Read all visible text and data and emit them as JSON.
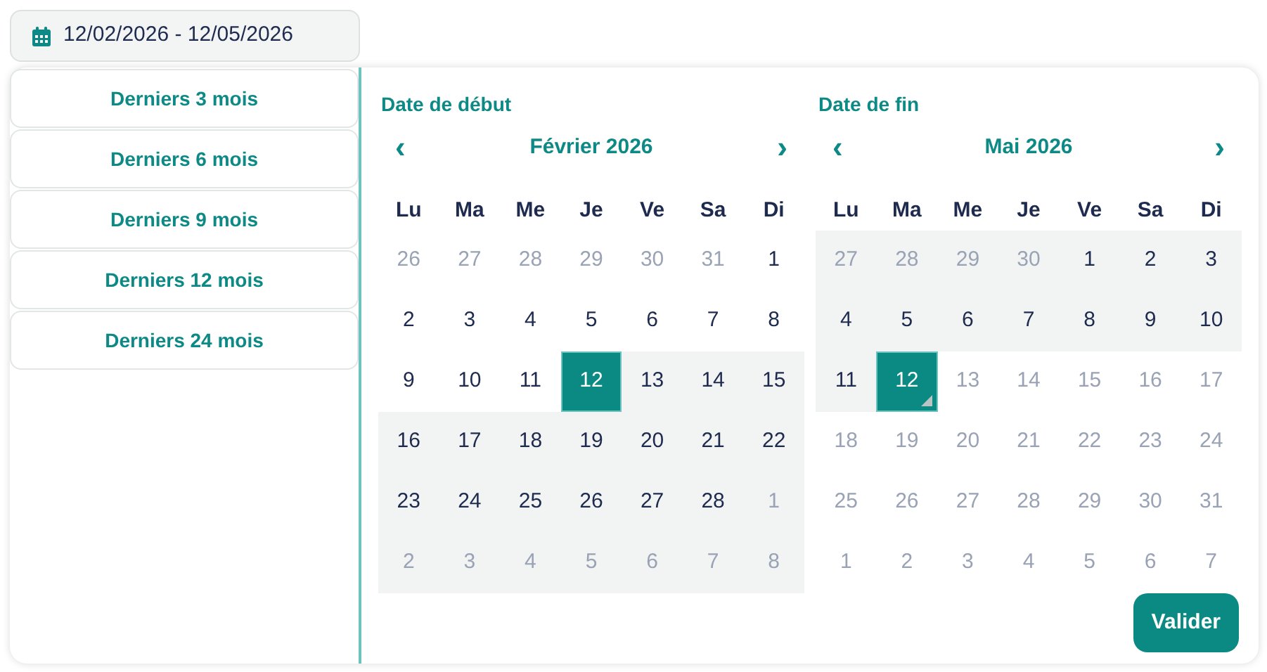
{
  "date_range_field": {
    "value": "12/02/2026 - 12/05/2026"
  },
  "presets": [
    {
      "label": "Derniers 3 mois"
    },
    {
      "label": "Derniers 6 mois"
    },
    {
      "label": "Derniers 9 mois"
    },
    {
      "label": "Derniers 12 mois"
    },
    {
      "label": "Derniers 24 mois"
    }
  ],
  "calendars": [
    {
      "heading": "Date de début",
      "month": "Février 2026",
      "prev": "‹",
      "next": "›",
      "weekdays": [
        "Lu",
        "Ma",
        "Me",
        "Je",
        "Ve",
        "Sa",
        "Di"
      ],
      "weeks": [
        [
          {
            "day": "26",
            "muted": true,
            "in_range": false,
            "selected": false
          },
          {
            "day": "27",
            "muted": true,
            "in_range": false,
            "selected": false
          },
          {
            "day": "28",
            "muted": true,
            "in_range": false,
            "selected": false
          },
          {
            "day": "29",
            "muted": true,
            "in_range": false,
            "selected": false
          },
          {
            "day": "30",
            "muted": true,
            "in_range": false,
            "selected": false
          },
          {
            "day": "31",
            "muted": true,
            "in_range": false,
            "selected": false
          },
          {
            "day": "1",
            "muted": false,
            "in_range": false,
            "selected": false
          }
        ],
        [
          {
            "day": "2",
            "muted": false,
            "in_range": false,
            "selected": false
          },
          {
            "day": "3",
            "muted": false,
            "in_range": false,
            "selected": false
          },
          {
            "day": "4",
            "muted": false,
            "in_range": false,
            "selected": false
          },
          {
            "day": "5",
            "muted": false,
            "in_range": false,
            "selected": false
          },
          {
            "day": "6",
            "muted": false,
            "in_range": false,
            "selected": false
          },
          {
            "day": "7",
            "muted": false,
            "in_range": false,
            "selected": false
          },
          {
            "day": "8",
            "muted": false,
            "in_range": false,
            "selected": false
          }
        ],
        [
          {
            "day": "9",
            "muted": false,
            "in_range": false,
            "selected": false
          },
          {
            "day": "10",
            "muted": false,
            "in_range": false,
            "selected": false
          },
          {
            "day": "11",
            "muted": false,
            "in_range": false,
            "selected": false
          },
          {
            "day": "12",
            "selected": true
          },
          {
            "day": "13",
            "muted": false,
            "in_range": true,
            "selected": false
          },
          {
            "day": "14",
            "muted": false,
            "in_range": true,
            "selected": false
          },
          {
            "day": "15",
            "muted": false,
            "in_range": true,
            "selected": false
          }
        ],
        [
          {
            "day": "16",
            "muted": false,
            "in_range": true,
            "selected": false
          },
          {
            "day": "17",
            "muted": false,
            "in_range": true,
            "selected": false
          },
          {
            "day": "18",
            "muted": false,
            "in_range": true,
            "selected": false
          },
          {
            "day": "19",
            "muted": false,
            "in_range": true,
            "selected": false
          },
          {
            "day": "20",
            "muted": false,
            "in_range": true,
            "selected": false
          },
          {
            "day": "21",
            "muted": false,
            "in_range": true,
            "selected": false
          },
          {
            "day": "22",
            "muted": false,
            "in_range": true,
            "selected": false
          }
        ],
        [
          {
            "day": "23",
            "muted": false,
            "in_range": true,
            "selected": false
          },
          {
            "day": "24",
            "muted": false,
            "in_range": true,
            "selected": false
          },
          {
            "day": "25",
            "muted": false,
            "in_range": true,
            "selected": false
          },
          {
            "day": "26",
            "muted": false,
            "in_range": true,
            "selected": false
          },
          {
            "day": "27",
            "muted": false,
            "in_range": true,
            "selected": false
          },
          {
            "day": "28",
            "muted": false,
            "in_range": true,
            "selected": false
          },
          {
            "day": "1",
            "muted": true,
            "in_range": true,
            "selected": false
          }
        ],
        [
          {
            "day": "2",
            "muted": true,
            "in_range": true,
            "selected": false
          },
          {
            "day": "3",
            "muted": true,
            "in_range": true,
            "selected": false
          },
          {
            "day": "4",
            "muted": true,
            "in_range": true,
            "selected": false
          },
          {
            "day": "5",
            "muted": true,
            "in_range": true,
            "selected": false
          },
          {
            "day": "6",
            "muted": true,
            "in_range": true,
            "selected": false
          },
          {
            "day": "7",
            "muted": true,
            "in_range": true,
            "selected": false
          },
          {
            "day": "8",
            "muted": true,
            "in_range": true,
            "selected": false
          }
        ]
      ]
    },
    {
      "heading": "Date de fin",
      "month": "Mai 2026",
      "prev": "‹",
      "next": "›",
      "weekdays": [
        "Lu",
        "Ma",
        "Me",
        "Je",
        "Ve",
        "Sa",
        "Di"
      ],
      "weeks": [
        [
          {
            "day": "27",
            "muted": true,
            "in_range": true,
            "selected": false
          },
          {
            "day": "28",
            "muted": true,
            "in_range": true,
            "selected": false
          },
          {
            "day": "29",
            "muted": true,
            "in_range": true,
            "selected": false
          },
          {
            "day": "30",
            "muted": true,
            "in_range": true,
            "selected": false
          },
          {
            "day": "1",
            "muted": false,
            "in_range": true,
            "selected": false
          },
          {
            "day": "2",
            "muted": false,
            "in_range": true,
            "selected": false
          },
          {
            "day": "3",
            "muted": false,
            "in_range": true,
            "selected": false
          }
        ],
        [
          {
            "day": "4",
            "muted": false,
            "in_range": true,
            "selected": false
          },
          {
            "day": "5",
            "muted": false,
            "in_range": true,
            "selected": false
          },
          {
            "day": "6",
            "muted": false,
            "in_range": true,
            "selected": false
          },
          {
            "day": "7",
            "muted": false,
            "in_range": true,
            "selected": false
          },
          {
            "day": "8",
            "muted": false,
            "in_range": true,
            "selected": false
          },
          {
            "day": "9",
            "muted": false,
            "in_range": true,
            "selected": false
          },
          {
            "day": "10",
            "muted": false,
            "in_range": true,
            "selected": false
          }
        ],
        [
          {
            "day": "11",
            "muted": false,
            "in_range": true,
            "selected": false
          },
          {
            "day": "12",
            "selected": true,
            "today": true
          },
          {
            "day": "13",
            "muted": true,
            "in_range": false,
            "selected": false
          },
          {
            "day": "14",
            "muted": true,
            "in_range": false,
            "selected": false
          },
          {
            "day": "15",
            "muted": true,
            "in_range": false,
            "selected": false
          },
          {
            "day": "16",
            "muted": true,
            "in_range": false,
            "selected": false
          },
          {
            "day": "17",
            "muted": true,
            "in_range": false,
            "selected": false
          }
        ],
        [
          {
            "day": "18",
            "muted": true,
            "in_range": false,
            "selected": false
          },
          {
            "day": "19",
            "muted": true,
            "in_range": false,
            "selected": false
          },
          {
            "day": "20",
            "muted": true,
            "in_range": false,
            "selected": false
          },
          {
            "day": "21",
            "muted": true,
            "in_range": false,
            "selected": false
          },
          {
            "day": "22",
            "muted": true,
            "in_range": false,
            "selected": false
          },
          {
            "day": "23",
            "muted": true,
            "in_range": false,
            "selected": false
          },
          {
            "day": "24",
            "muted": true,
            "in_range": false,
            "selected": false
          }
        ],
        [
          {
            "day": "25",
            "muted": true,
            "in_range": false,
            "selected": false
          },
          {
            "day": "26",
            "muted": true,
            "in_range": false,
            "selected": false
          },
          {
            "day": "27",
            "muted": true,
            "in_range": false,
            "selected": false
          },
          {
            "day": "28",
            "muted": true,
            "in_range": false,
            "selected": false
          },
          {
            "day": "29",
            "muted": true,
            "in_range": false,
            "selected": false
          },
          {
            "day": "30",
            "muted": true,
            "in_range": false,
            "selected": false
          },
          {
            "day": "31",
            "muted": true,
            "in_range": false,
            "selected": false
          }
        ],
        [
          {
            "day": "1",
            "muted": true,
            "in_range": false,
            "selected": false
          },
          {
            "day": "2",
            "muted": true,
            "in_range": false,
            "selected": false
          },
          {
            "day": "3",
            "muted": true,
            "in_range": false,
            "selected": false
          },
          {
            "day": "4",
            "muted": true,
            "in_range": false,
            "selected": false
          },
          {
            "day": "5",
            "muted": true,
            "in_range": false,
            "selected": false
          },
          {
            "day": "6",
            "muted": true,
            "in_range": false,
            "selected": false
          },
          {
            "day": "7",
            "muted": true,
            "in_range": false,
            "selected": false
          }
        ]
      ]
    }
  ],
  "confirm_button": {
    "label": "Valider"
  }
}
